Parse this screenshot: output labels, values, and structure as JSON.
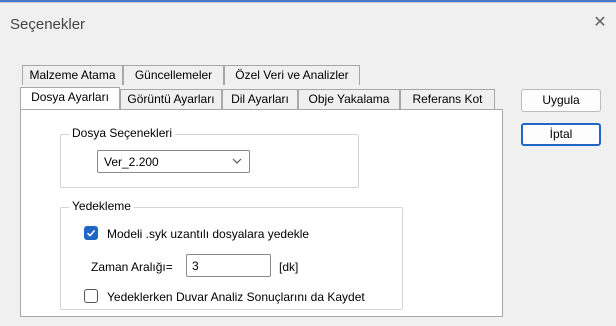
{
  "window": {
    "title": "Seçenekler",
    "close_glyph": "✕"
  },
  "tabs_row1": [
    {
      "label": "Malzeme Atama"
    },
    {
      "label": "Güncellemeler"
    },
    {
      "label": "Özel Veri ve Analizler"
    }
  ],
  "tabs_row2": [
    {
      "label": "Dosya Ayarları",
      "active": true
    },
    {
      "label": "Görüntü Ayarları"
    },
    {
      "label": "Dil Ayarları"
    },
    {
      "label": "Obje Yakalama"
    },
    {
      "label": "Referans Kot"
    }
  ],
  "file_options": {
    "group_label": "Dosya Seçenekleri",
    "version_value": "Ver_2.200"
  },
  "backup": {
    "group_label": "Yedekleme",
    "backup_checkbox_label": "Modeli .syk uzantılı dosyalara yedekle",
    "backup_checked": true,
    "interval_label": "Zaman Aralığı=",
    "interval_value": "3",
    "interval_unit": "[dk]",
    "save_results_label": "Yedeklerken Duvar Analiz Sonuçlarını da Kaydet",
    "save_results_checked": false
  },
  "buttons": {
    "apply": "Uygula",
    "cancel": "İptal"
  },
  "colors": {
    "accent": "#1f66c7"
  }
}
